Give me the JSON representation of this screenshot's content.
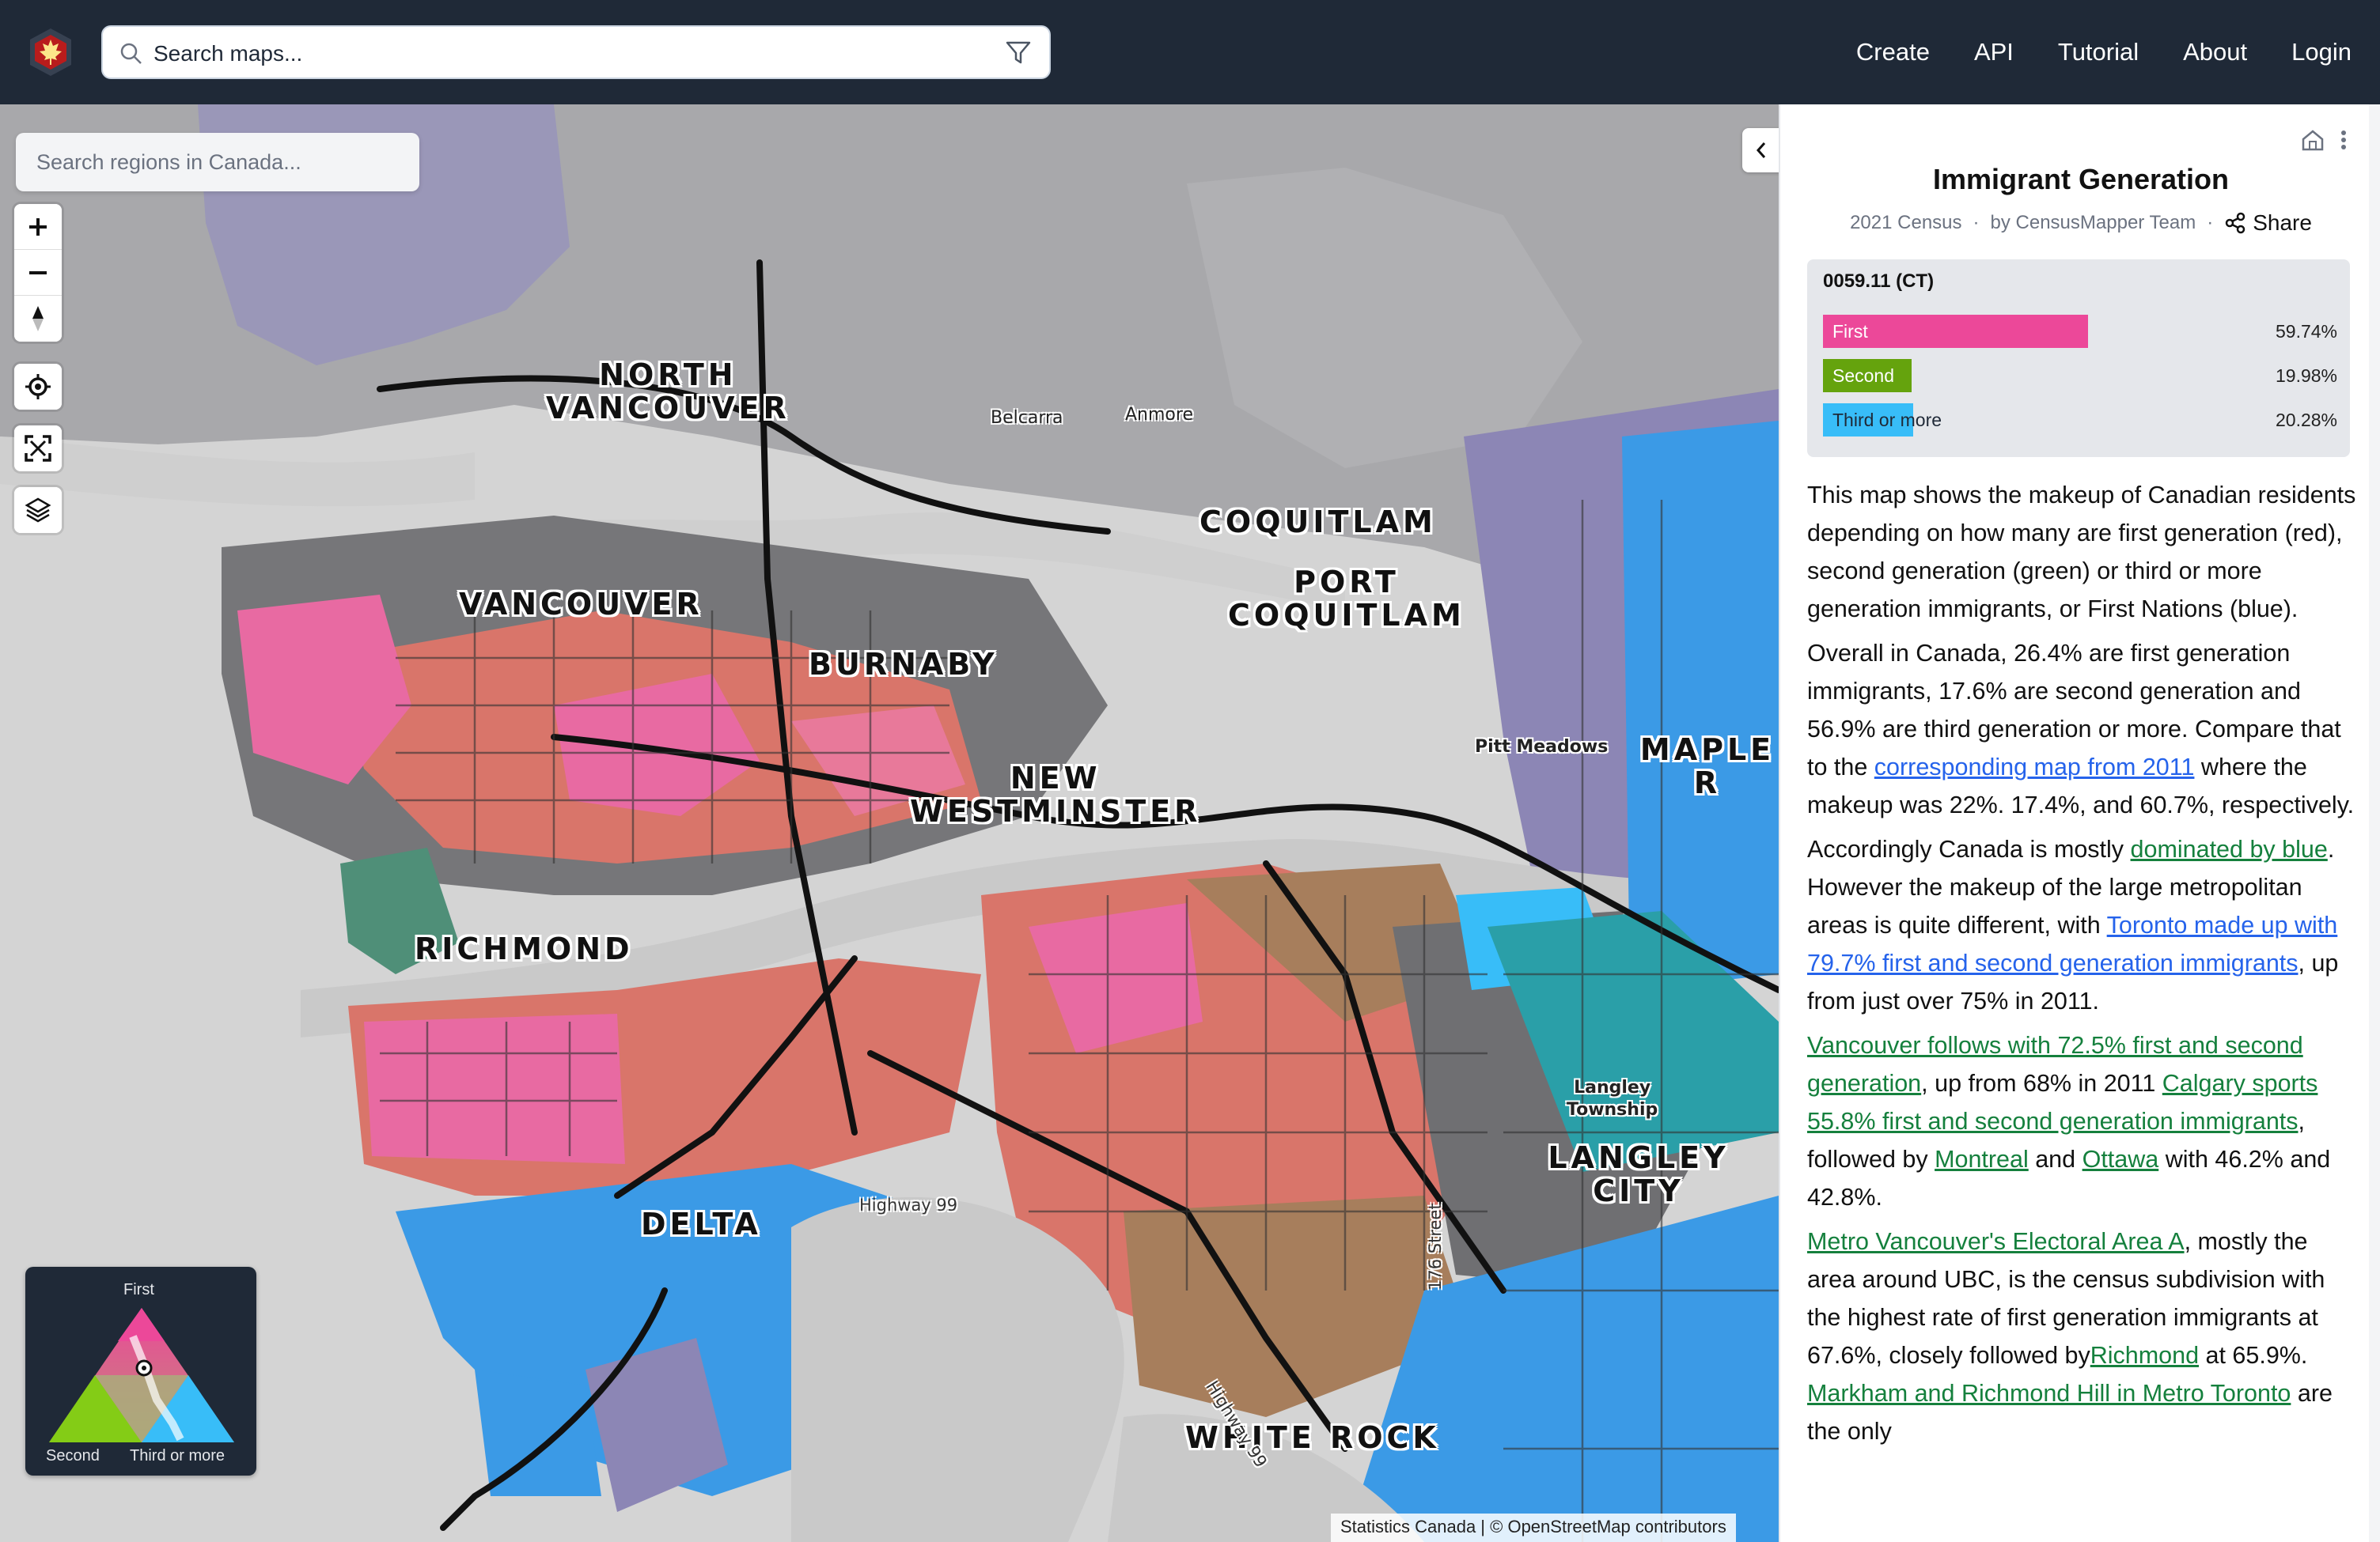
{
  "header": {
    "search_placeholder": "Search maps...",
    "nav": [
      "Create",
      "API",
      "Tutorial",
      "About",
      "Login"
    ]
  },
  "map": {
    "region_search_placeholder": "Search regions in Canada...",
    "city_labels": {
      "north_vancouver": "NORTH\nVANCOUVER",
      "vancouver": "VANCOUVER",
      "burnaby": "BURNABY",
      "coquitlam": "COQUITLAM",
      "port_coquitlam": "PORT\nCOQUITLAM",
      "new_westminster": "NEW\nWESTMINSTER",
      "richmond": "RICHMOND",
      "delta": "DELTA",
      "langley_city": "LANGLEY CITY",
      "white_rock": "WHITE ROCK",
      "maple_ridge": "MAPLE R"
    },
    "small_labels": {
      "belcarra": "Belcarra",
      "anmore": "Anmore",
      "pitt_meadows": "Pitt Meadows",
      "langley_township": "Langley\nTownship"
    },
    "road_labels": {
      "highway99_a": "Highway 99",
      "highway99_b": "Highway 99",
      "street176": "176 Street"
    },
    "legend": {
      "top": "First",
      "left": "Second",
      "right": "Third or more"
    },
    "attribution": "Statistics Canada | © OpenStreetMap contributors",
    "colors": {
      "first": "#ec4899",
      "second": "#84cc16",
      "third": "#38bdf8"
    }
  },
  "panel": {
    "title": "Immigrant Generation",
    "census": "2021 Census",
    "author": "by CensusMapper Team",
    "share": "Share",
    "region": {
      "title": "0059.11 (CT)",
      "bars": [
        {
          "label": "First",
          "value": "59.74%",
          "fraction": 0.5974,
          "color": "#ec4899"
        },
        {
          "label": "Second",
          "value": "19.98%",
          "fraction": 0.1998,
          "color": "#65a30d"
        },
        {
          "label": "Third or more",
          "value": "20.28%",
          "fraction": 0.2028,
          "color": "#38bdf8"
        }
      ]
    },
    "description": {
      "p1": "This map shows the makeup of Canadian residents depending on how many are first generation (red), second generation (green) or third or more generation immigrants, or First Nations (blue).",
      "p2_a": "Overall in Canada, 26.4% are first generation immigrants, 17.6% are second generation and 56.9% are third generation or more. Compare that to the ",
      "p2_link": "corresponding map from 2011",
      "p2_b": " where the makeup was 22%. 17.4%, and 60.7%, respectively.",
      "p3_a": "Accordingly Canada is mostly ",
      "p3_link1": "dominated by blue",
      "p3_b": ". However the makeup of the large metropolitan areas is quite different, with ",
      "p3_link2": "Toronto made up with 79.7% first and second generation immigrants",
      "p3_c": ", up from just over 75% in 2011.",
      "p4_link1": "Vancouver follows with 72.5% first and second generation",
      "p4_a": ", up from 68% in 2011 ",
      "p4_link2": "Calgary sports 55.8% first and second generation immigrants",
      "p4_b": ", followed by ",
      "p4_link3": "Montreal",
      "p4_c": " and ",
      "p4_link4": "Ottawa",
      "p4_d": " with 46.2% and 42.8%.",
      "p5_link1": "Metro Vancouver's Electoral Area A",
      "p5_a": ", mostly the area around UBC, is the census subdivision with the highest rate of first generation immigrants at 67.6%, closely followed by",
      "p5_link2": "Richmond",
      "p5_b": " at 65.9%. ",
      "p5_link3": "Markham and Richmond Hill in Metro Toronto",
      "p5_c": " are the only"
    }
  }
}
